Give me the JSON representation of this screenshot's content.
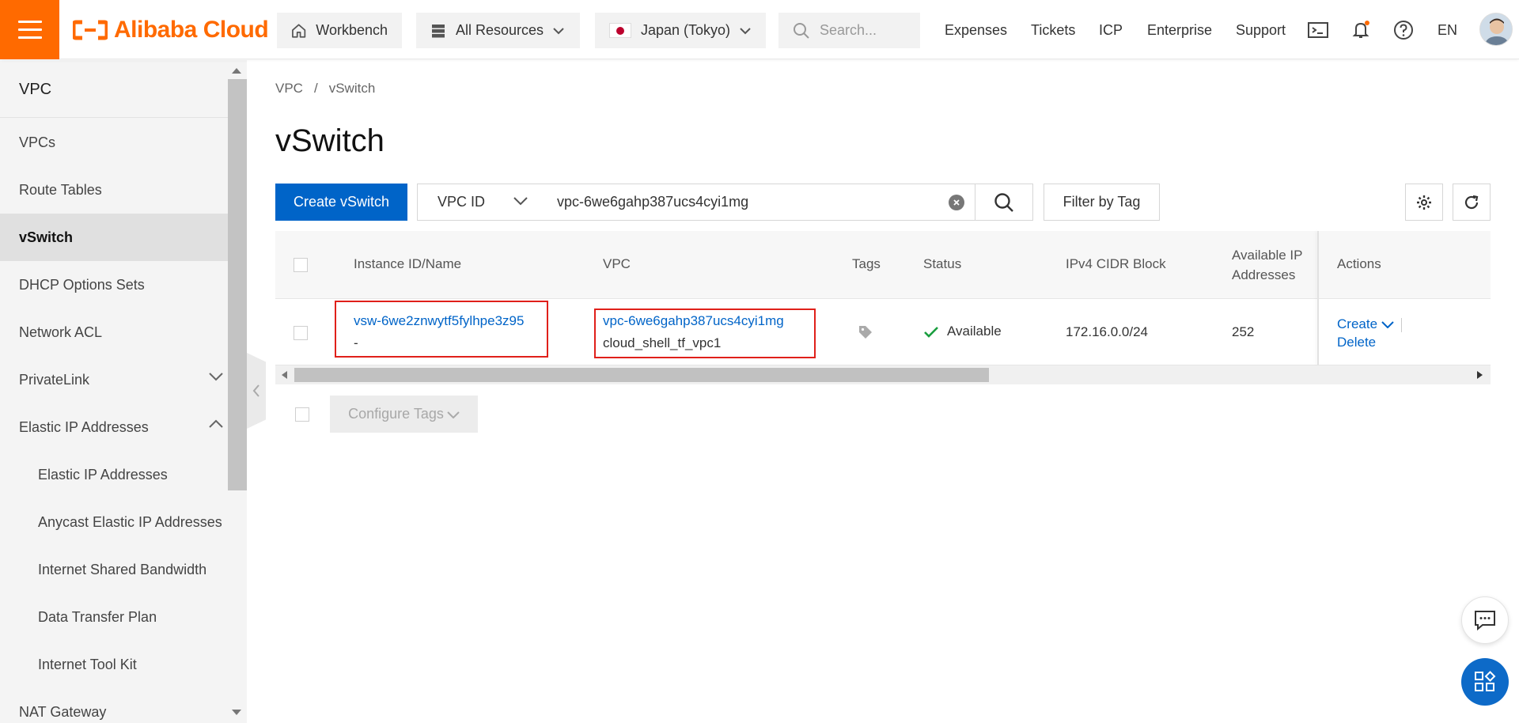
{
  "header": {
    "logo_text": "Alibaba Cloud",
    "workbench": "Workbench",
    "all_resources": "All Resources",
    "region": "Japan (Tokyo)",
    "search_placeholder": "Search...",
    "links": [
      "Expenses",
      "Tickets",
      "ICP",
      "Enterprise",
      "Support"
    ],
    "language": "EN",
    "brand_color": "#ff6a00"
  },
  "sidebar": {
    "title": "VPC",
    "items": [
      {
        "label": "VPCs"
      },
      {
        "label": "Route Tables"
      },
      {
        "label": "vSwitch"
      },
      {
        "label": "DHCP Options Sets"
      },
      {
        "label": "Network ACL"
      },
      {
        "label": "PrivateLink"
      },
      {
        "label": "Elastic IP Addresses"
      },
      {
        "label": "Elastic IP Addresses"
      },
      {
        "label": "Anycast Elastic IP Addresses"
      },
      {
        "label": "Internet Shared Bandwidth"
      },
      {
        "label": "Data Transfer Plan"
      },
      {
        "label": "Internet Tool Kit"
      },
      {
        "label": "NAT Gateway"
      }
    ]
  },
  "breadcrumb": [
    "VPC",
    "vSwitch"
  ],
  "page_title": "vSwitch",
  "toolbar": {
    "create_label": "Create vSwitch",
    "filter_field": "VPC ID",
    "search_value": "vpc-6we6gahp387ucs4cyi1mg",
    "filter_by_tag": "Filter by Tag"
  },
  "table": {
    "headers": [
      "Instance ID/Name",
      "VPC",
      "Tags",
      "Status",
      "IPv4 CIDR Block",
      "Available IP Addresses",
      "Actions"
    ],
    "rows": [
      {
        "instance_id": "vsw-6we2znwytf5fylhpe3z95",
        "instance_name": "-",
        "vpc_id": "vpc-6we6gahp387ucs4cyi1mg",
        "vpc_name": "cloud_shell_tf_vpc1",
        "status": "Available",
        "cidr": "172.16.0.0/24",
        "available_ips": "252",
        "action_create": "Create",
        "action_delete": "Delete"
      }
    ]
  },
  "footer_actions": {
    "configure_tags": "Configure Tags"
  }
}
